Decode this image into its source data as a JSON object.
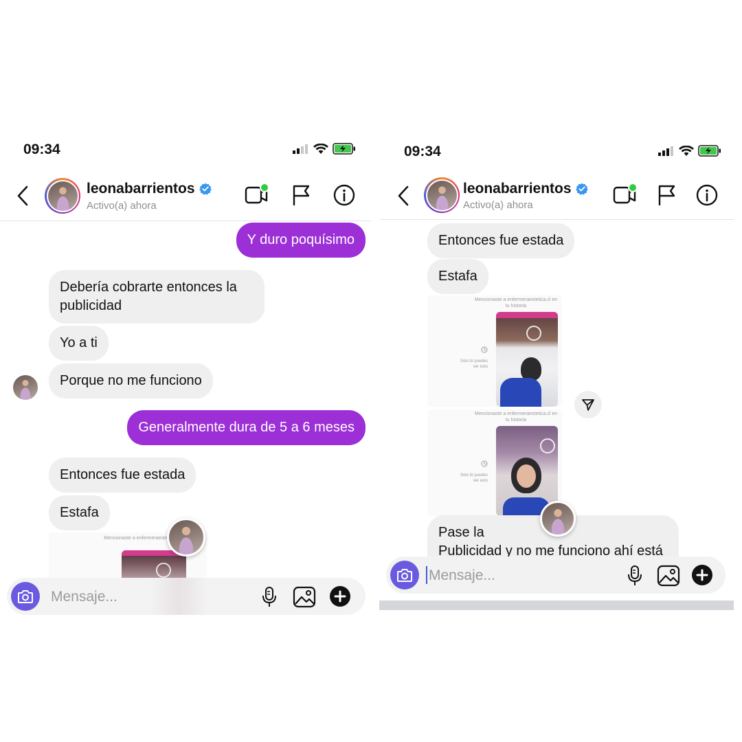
{
  "left_panel": {
    "status": {
      "time": "09:34"
    },
    "header": {
      "username": "leonabarrientos",
      "activity": "Activo(a) ahora"
    },
    "messages": [
      {
        "id": "l1",
        "direction": "outgoing",
        "text": "Y duro poquísimo"
      },
      {
        "id": "l2",
        "direction": "incoming",
        "lines": [
          "Debería cobrarte entonces la",
          "publicidad"
        ]
      },
      {
        "id": "l3",
        "direction": "incoming",
        "text": "Yo a ti"
      },
      {
        "id": "l4",
        "direction": "incoming",
        "text": "Porque no me funciono"
      },
      {
        "id": "l5",
        "direction": "outgoing",
        "text": "Generalmente dura de 5 a 6 meses"
      },
      {
        "id": "l6",
        "direction": "incoming",
        "text": "Entonces fue estada"
      },
      {
        "id": "l7",
        "direction": "incoming",
        "text": "Estafa"
      }
    ],
    "story_caption": "Mencionaste a enfermeraestetica",
    "composer": {
      "placeholder": "Mensaje..."
    }
  },
  "right_panel": {
    "status": {
      "time": "09:34"
    },
    "header": {
      "username": "leonabarrientos",
      "activity": "Activo(a) ahora"
    },
    "messages": [
      {
        "id": "r1",
        "direction": "incoming",
        "text": "Entonces fue estada"
      },
      {
        "id": "r2",
        "direction": "incoming",
        "text": "Estafa"
      },
      {
        "id": "r3",
        "direction": "incoming",
        "lines": [
          "Pase la",
          "Publicidad y no me funciono ahí está"
        ]
      }
    ],
    "story_mentions": [
      {
        "caption_1": "Mencionaste a enfermeraestetica.cl en",
        "caption_2": "tu historia",
        "side_1": "Solo tú puedes",
        "side_2": "ver esto"
      },
      {
        "caption_1": "Mencionaste a enfermeraestetica.cl en",
        "caption_2": "tu historia",
        "side_1": "Solo tú puedes",
        "side_2": "ver esto"
      }
    ],
    "composer": {
      "placeholder": "Mensaje..."
    }
  },
  "colors": {
    "outgoing_bubble": "#9c2fd6",
    "incoming_bubble": "#efefef",
    "camera_button": "#6a5ae0",
    "verified_badge": "#3897f0",
    "online_dot": "#2ecc40"
  },
  "icons": [
    "back-arrow-icon",
    "verified-badge-icon",
    "video-call-icon",
    "flag-icon",
    "info-icon",
    "camera-icon",
    "microphone-icon",
    "gallery-icon",
    "plus-icon",
    "send-icon",
    "wifi-icon",
    "signal-icon",
    "battery-icon"
  ]
}
